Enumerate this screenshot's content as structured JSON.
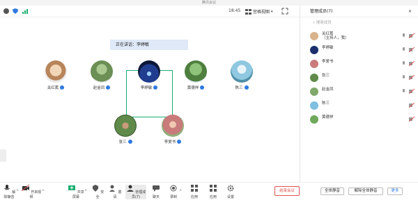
{
  "window": {
    "title": "腾讯会议"
  },
  "topbar": {
    "timer": "18:45",
    "view_label": "宫格视图"
  },
  "main": {
    "caption": "正在讲话：李婷敏",
    "participants": [
      {
        "name": "关红蕉",
        "avatar_color": "#d9b38c"
      },
      {
        "name": "赵金凤",
        "avatar_color": "#7fa86a"
      },
      {
        "name": "李婷敏",
        "avatar_color": "#1b2f6e"
      },
      {
        "name": "黄德祥",
        "avatar_color": "#6fa85a"
      },
      {
        "name": "陈三",
        "avatar_color": "#7fbfe0"
      },
      {
        "name": "张三",
        "avatar_color": "#5f8a4a"
      },
      {
        "name": "李爱书",
        "avatar_color": "#c97b7b"
      }
    ]
  },
  "toolbar": {
    "mute": "解除静音",
    "video": "开启视频",
    "share": "共享屏幕",
    "security": "安全",
    "invite": "邀请",
    "manage": "管理成员(7)",
    "chat": "聊天",
    "record": "录制",
    "apps": "应用",
    "settings": "设置",
    "leave": "结束会议",
    "mute_all": "全体静音",
    "unmute_all": "解除全体静音",
    "more": "更多"
  },
  "panel": {
    "title": "管理成员(7)",
    "search_placeholder": "搜索成员",
    "members": [
      {
        "name": "关红蕉",
        "sub": "（主持人，我）",
        "avatar_color": "#d9b38c"
      },
      {
        "name": "李婷敏",
        "sub": "",
        "avatar_color": "#1b2f6e"
      },
      {
        "name": "李爱书",
        "sub": "",
        "avatar_color": "#c97b7b"
      },
      {
        "name": "张三",
        "sub": "",
        "avatar_color": "#5f8a4a"
      },
      {
        "name": "赵金凤",
        "sub": "",
        "avatar_color": "#7fa86a"
      },
      {
        "name": "陈三",
        "sub": "",
        "avatar_color": "#7fbfe0"
      },
      {
        "name": "黄德祥",
        "sub": "",
        "avatar_color": "#6fa85a"
      }
    ]
  }
}
